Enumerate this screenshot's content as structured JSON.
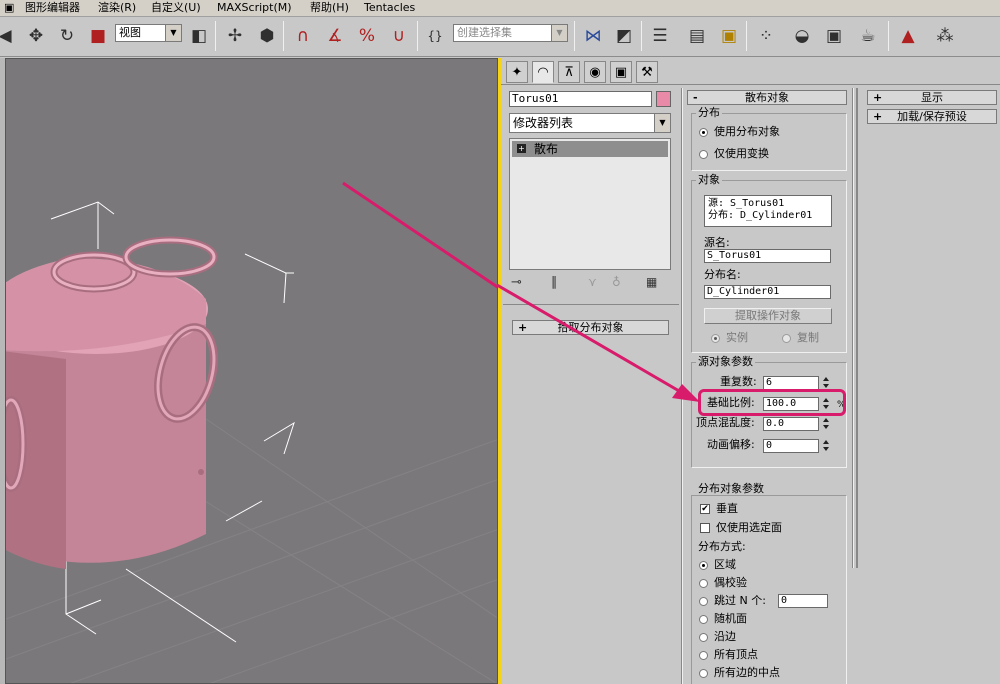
{
  "menu": {
    "items": [
      "图形编辑器",
      "渲染(R)",
      "自定义(U)",
      "MAXScript(M)",
      "帮助(H)",
      "Tentacles"
    ]
  },
  "toolbar": {
    "view_combo": "视图",
    "selection_set_placeholder": "创建选择集",
    "icons": [
      "move-icon",
      "rotate-icon",
      "scale-icon",
      "mirror-icon",
      "align-icon",
      "layers-icon",
      "curve-editor-icon",
      "schematic-icon",
      "material-editor-icon",
      "render-setup-icon",
      "render-icon"
    ]
  },
  "object_name": "Torus01",
  "object_color": "#e88aa8",
  "modifier_list": "修改器列表",
  "modifier_stack": [
    "散布"
  ],
  "pick_rollout": "拾取分布对象",
  "scatter": {
    "title": "散布对象",
    "distribution": {
      "group": "分布",
      "use_dist": "使用分布对象",
      "transform_only": "仅使用变换"
    },
    "objects": {
      "group": "对象",
      "list": [
        "源: S_Torus01",
        "分布: D_Cylinder01"
      ],
      "source_name_label": "源名:",
      "source_name": "S_Torus01",
      "dist_name_label": "分布名:",
      "dist_name": "D_Cylinder01",
      "extract_button": "提取操作对象",
      "instance": "实例",
      "copy": "复制"
    },
    "source_params": {
      "group": "源对象参数",
      "duplicates_label": "重复数:",
      "duplicates": "6",
      "base_scale_label": "基础比例:",
      "base_scale": "100.0",
      "percent": "%",
      "vertex_chaos_label": "顶点混乱度:",
      "vertex_chaos": "0.0",
      "anim_offset_label": "动画偏移:",
      "anim_offset": "0"
    },
    "dist_params": {
      "group": "分布对象参数",
      "perpendicular": "垂直",
      "selected_faces": "仅使用选定面",
      "method_label": "分布方式:",
      "area": "区域",
      "even": "偶校验",
      "skip_n": "跳过 N 个:",
      "skip_n_value": "0",
      "random_faces": "随机面",
      "along_edges": "沿边",
      "all_vertices": "所有顶点",
      "all_edge_midpoints": "所有边的中点"
    }
  },
  "right_rollouts": [
    "显示",
    "加载/保存预设"
  ],
  "colors": {
    "viewport_bg": "#7b787b",
    "object_pink": "#d08aa0",
    "highlight": "#d81b6a",
    "active_yellow": "#f5d418"
  }
}
